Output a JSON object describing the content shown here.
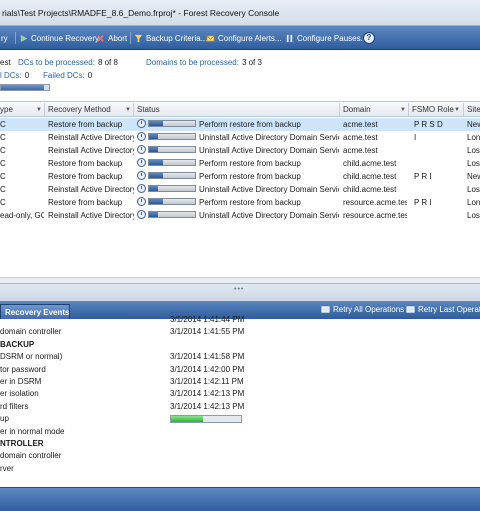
{
  "window": {
    "title": "rials\\Test Projects\\RMADFE_8.6_Demo.frproj* - Forest Recovery Console"
  },
  "toolbar": {
    "items": [
      {
        "label": "ry",
        "icon": "start-recovery-icon"
      },
      {
        "label": "Continue Recovery",
        "icon": "continue-icon"
      },
      {
        "label": "Abort",
        "icon": "abort-icon"
      },
      {
        "label": "Backup Criteria...",
        "icon": "filter-icon"
      },
      {
        "label": "Configure Alerts...",
        "icon": "alert-icon"
      },
      {
        "label": "Configure Pauses...",
        "icon": "pause-icon"
      }
    ],
    "help_label": "?"
  },
  "summary": {
    "row1_prefix": "est",
    "dcs_processed_label": "DCs to be processed:",
    "dcs_processed_value": "8 of 8",
    "domains_processed_label": "Domains to be processed:",
    "domains_processed_value": "3 of 3",
    "row2_prefix": "l DCs:",
    "row2_value": "0",
    "failed_label": "Failed DCs:",
    "failed_value": "0",
    "overall_progress": 0.9
  },
  "grid": {
    "columns": [
      "ype",
      "Recovery Method",
      "Status",
      "Domain",
      "FSMO Role",
      "Site"
    ],
    "rows": [
      {
        "type": "C",
        "method": "Restore from backup",
        "progress": 0.3,
        "status": "Perform restore from backup",
        "domain": "acme.test",
        "fsmo": "P  R   S  D",
        "site": "New",
        "selected": true
      },
      {
        "type": "C",
        "method": "Reinstall Active Directory",
        "progress": 0.2,
        "status": "Uninstall Active Directory Domain Services",
        "domain": "acme.test",
        "fsmo": "I",
        "site": "Lonc",
        "selected": false
      },
      {
        "type": "C",
        "method": "Reinstall Active Directory",
        "progress": 0.2,
        "status": "Uninstall Active Directory Domain Services",
        "domain": "acme.test",
        "fsmo": "",
        "site": "Los A",
        "selected": false
      },
      {
        "type": "C",
        "method": "Restore from backup",
        "progress": 0.3,
        "status": "Perform restore from backup",
        "domain": "child.acme.test",
        "fsmo": "",
        "site": "Los A",
        "selected": false
      },
      {
        "type": "C",
        "method": "Restore from backup",
        "progress": 0.3,
        "status": "Perform restore from backup",
        "domain": "child.acme.test",
        "fsmo": "P  R  I",
        "site": "New",
        "selected": false
      },
      {
        "type": "C",
        "method": "Reinstall Active Directory",
        "progress": 0.2,
        "status": "Uninstall Active Directory Domain Services",
        "domain": "child.acme.test",
        "fsmo": "",
        "site": "Los A",
        "selected": false
      },
      {
        "type": "C",
        "method": "Restore from backup",
        "progress": 0.3,
        "status": "Perform restore from backup",
        "domain": "resource.acme.test",
        "fsmo": "P  R  I",
        "site": "Lonc",
        "selected": false
      },
      {
        "type": "ead-only, GC",
        "method": "Reinstall Active Directory",
        "progress": 0.2,
        "status": "Uninstall Active Directory Domain Services",
        "domain": "resource.acme.test",
        "fsmo": "",
        "site": "Los A",
        "selected": false
      }
    ]
  },
  "bottom": {
    "tab_label": "Recovery Events",
    "retry_all": "Retry All Operations",
    "retry_last": "Retry Last Operation"
  },
  "events": [
    {
      "name": "",
      "time": "3/1/2014 1:41:44 PM",
      "heading": false
    },
    {
      "name": "domain controller",
      "time": "3/1/2014 1:41:55 PM",
      "heading": false
    },
    {
      "name": "BACKUP",
      "time": "",
      "heading": true
    },
    {
      "name": "DSRM or normal)",
      "time": "3/1/2014 1:41:58 PM",
      "heading": false
    },
    {
      "name": "tor password",
      "time": "3/1/2014 1:42:00 PM",
      "heading": false
    },
    {
      "name": "er in DSRM",
      "time": "3/1/2014 1:42:11 PM",
      "heading": false
    },
    {
      "name": "er isolation",
      "time": "3/1/2014 1:42:13 PM",
      "heading": false
    },
    {
      "name": "rd filters",
      "time": "3/1/2014 1:42:13 PM",
      "heading": false
    },
    {
      "name": "up",
      "time": "",
      "heading": false,
      "progress": 0.45
    },
    {
      "name": "er in normal mode",
      "time": "",
      "heading": false
    },
    {
      "name": "NTROLLER",
      "time": "",
      "heading": true
    },
    {
      "name": "domain controller",
      "time": "",
      "heading": false
    },
    {
      "name": "rver",
      "time": "",
      "heading": false
    }
  ]
}
